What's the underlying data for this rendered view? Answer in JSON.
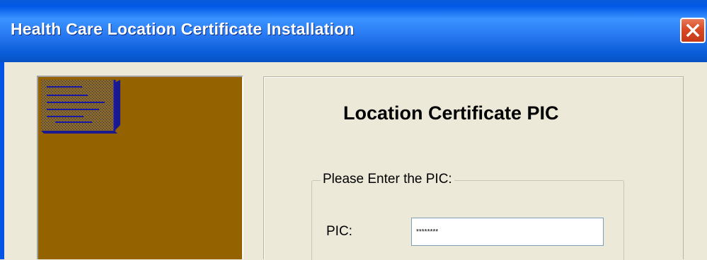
{
  "window": {
    "title": "Health Care Location Certificate Installation",
    "close_icon": "close-icon"
  },
  "side_panel": {
    "icon": "certificate-document-icon",
    "background_color": "#956200"
  },
  "main": {
    "heading": "Location Certificate PIC",
    "group": {
      "legend": "Please Enter the PIC:",
      "pic_label": "PIC:",
      "pic_value": "********"
    }
  },
  "colors": {
    "titlebar": "#0A5CD8",
    "dialog_bg": "#ECE9D8",
    "close_button": "#D84A24"
  }
}
